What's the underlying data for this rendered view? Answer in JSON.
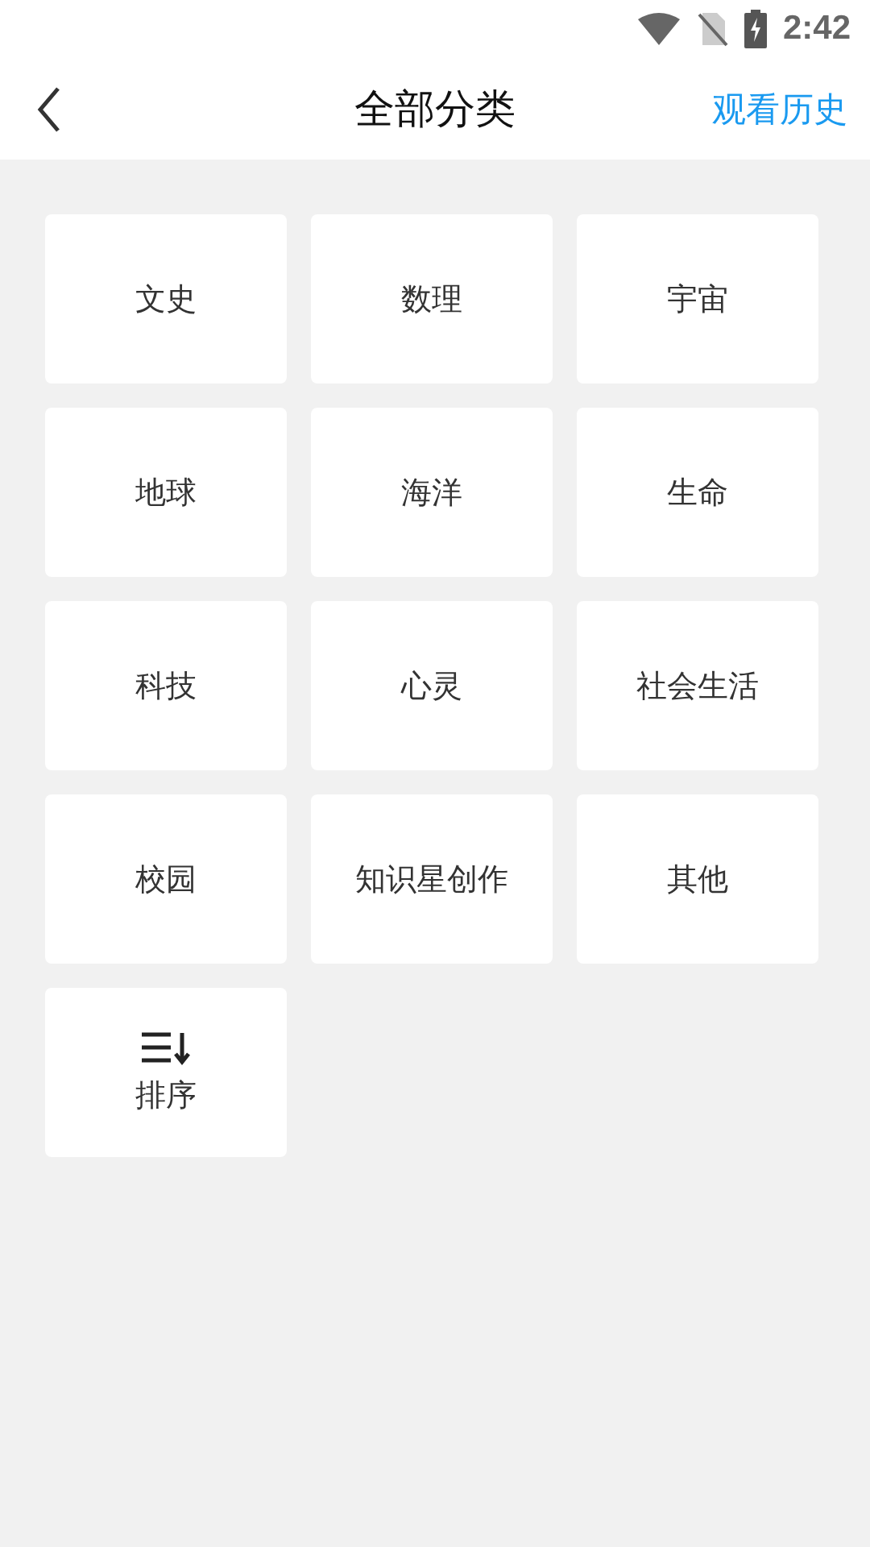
{
  "status_bar": {
    "time": "2:42"
  },
  "header": {
    "title": "全部分类",
    "action": "观看历史"
  },
  "tiles": [
    {
      "kind": "category",
      "label": "文史"
    },
    {
      "kind": "category",
      "label": "数理"
    },
    {
      "kind": "category",
      "label": "宇宙"
    },
    {
      "kind": "category",
      "label": "地球"
    },
    {
      "kind": "category",
      "label": "海洋"
    },
    {
      "kind": "category",
      "label": "生命"
    },
    {
      "kind": "category",
      "label": "科技"
    },
    {
      "kind": "category",
      "label": "心灵"
    },
    {
      "kind": "category",
      "label": "社会生活"
    },
    {
      "kind": "category",
      "label": "校园"
    },
    {
      "kind": "category",
      "label": "知识星创作"
    },
    {
      "kind": "category",
      "label": "其他"
    },
    {
      "kind": "sort",
      "label": "排序"
    }
  ]
}
